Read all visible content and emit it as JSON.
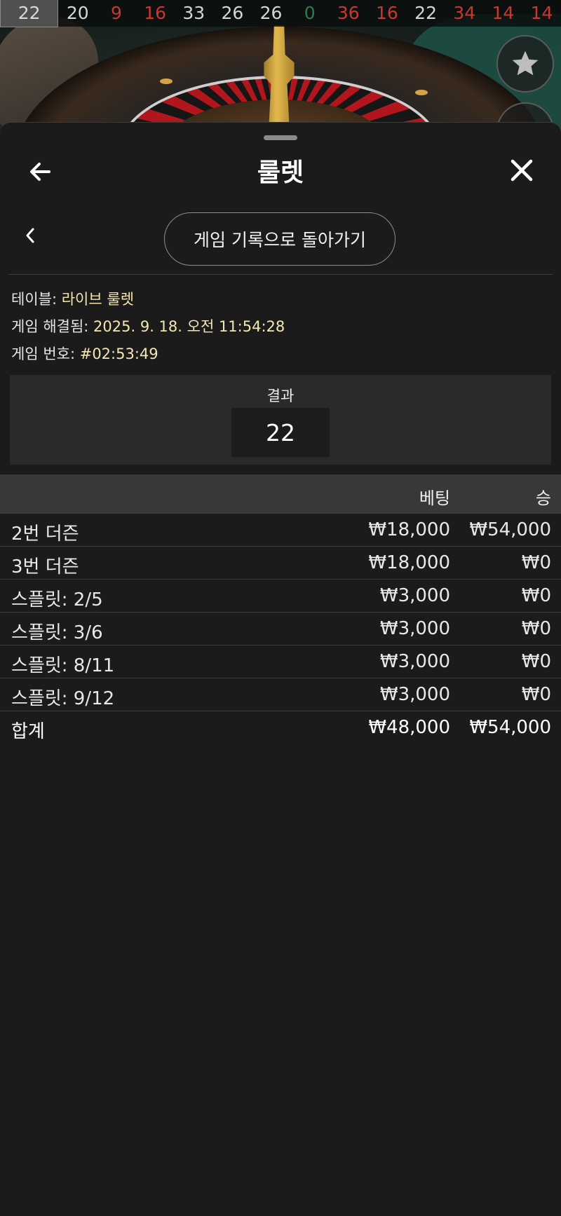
{
  "history": [
    {
      "value": "22",
      "color": "first"
    },
    {
      "value": "20",
      "color": "black"
    },
    {
      "value": "9",
      "color": "red"
    },
    {
      "value": "16",
      "color": "red"
    },
    {
      "value": "33",
      "color": "black"
    },
    {
      "value": "26",
      "color": "black"
    },
    {
      "value": "26",
      "color": "black"
    },
    {
      "value": "0",
      "color": "green"
    },
    {
      "value": "36",
      "color": "red"
    },
    {
      "value": "16",
      "color": "red"
    },
    {
      "value": "22",
      "color": "black"
    },
    {
      "value": "34",
      "color": "red"
    },
    {
      "value": "14",
      "color": "red"
    },
    {
      "value": "14",
      "color": "red"
    }
  ],
  "sheet": {
    "title": "룰렛",
    "back_to_history": "게임 기록으로 돌아가기"
  },
  "details": {
    "table_label": "테이블:",
    "table_value": "라이브 룰렛",
    "resolved_label": "게임 해결됨:",
    "resolved_value": "2025. 9. 18. 오전 11:54:28",
    "game_no_label": "게임 번호:",
    "game_no_value": "#02:53:49"
  },
  "result": {
    "label": "결과",
    "number": "22"
  },
  "bets_table": {
    "headers": {
      "bet": "베팅",
      "win": "승"
    },
    "rows": [
      {
        "name": "2번 더즌",
        "bet": "₩18,000",
        "win": "₩54,000"
      },
      {
        "name": "3번 더즌",
        "bet": "₩18,000",
        "win": "₩0"
      },
      {
        "name": "스플릿: 2/5",
        "bet": "₩3,000",
        "win": "₩0"
      },
      {
        "name": "스플릿: 3/6",
        "bet": "₩3,000",
        "win": "₩0"
      },
      {
        "name": "스플릿: 8/11",
        "bet": "₩3,000",
        "win": "₩0"
      },
      {
        "name": "스플릿: 9/12",
        "bet": "₩3,000",
        "win": "₩0"
      }
    ],
    "total": {
      "name": "합계",
      "bet": "₩48,000",
      "win": "₩54,000"
    }
  },
  "icons": {
    "favorite": "star-icon",
    "back": "arrow-left-icon",
    "close": "close-icon",
    "previous": "chevron-left-icon"
  },
  "colors": {
    "red_number": "#c9372f",
    "green_number": "#2e7a4f",
    "detail_value": "#f4e6b0",
    "sheet_bg": "#1b1b1b"
  }
}
